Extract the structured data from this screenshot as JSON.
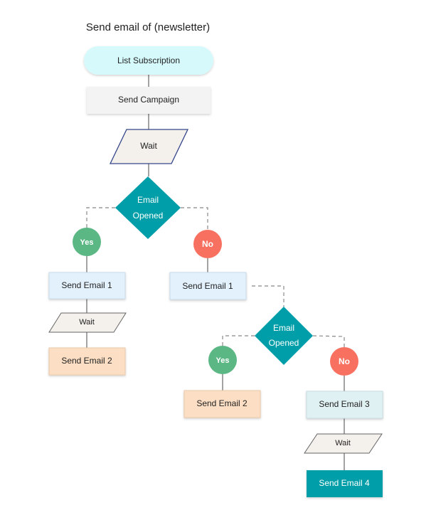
{
  "title": "Send email of (newsletter)",
  "colors": {
    "start": "#d6fafc",
    "process": "#f3f3f3",
    "wait": "#f4f0ec",
    "decision": "#009ea8",
    "yes": "#5bb784",
    "no": "#f87160",
    "email1": "#e3f1fc",
    "email2": "#fbdec3",
    "email3": "#e0f1f3",
    "email4": "#009ea8"
  },
  "nodes": {
    "start": "List Subscription",
    "campaign": "Send Campaign",
    "wait1": "Wait",
    "decision1": {
      "line1": "Email",
      "line2": "Opened"
    },
    "yes1": "Yes",
    "no1": "No",
    "yes1_email1": "Send Email 1",
    "yes1_wait": "Wait",
    "yes1_email2": "Send Email 2",
    "no1_email1": "Send Email 1",
    "decision2": {
      "line1": "Email",
      "line2": "Opened"
    },
    "yes2": "Yes",
    "no2": "No",
    "yes2_email2": "Send Email 2",
    "no2_email3": "Send Email 3",
    "no2_wait": "Wait",
    "no2_email4": "Send Email 4"
  }
}
